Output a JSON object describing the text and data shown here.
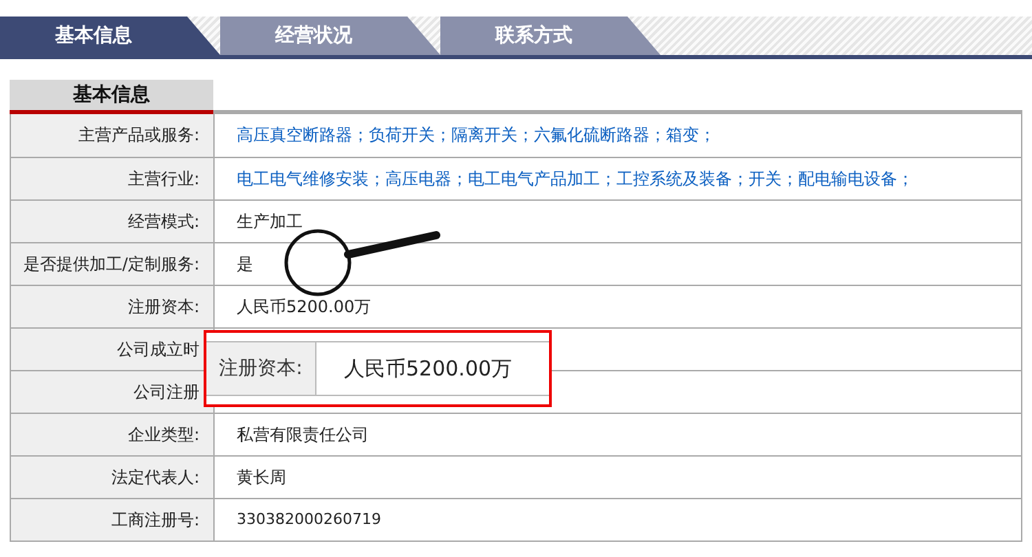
{
  "tabs": [
    {
      "label": "基本信息",
      "selected": true
    },
    {
      "label": "经营状况",
      "selected": false
    },
    {
      "label": "联系方式",
      "selected": false
    }
  ],
  "section_title": "基本信息",
  "rows": [
    {
      "label": "主营产品或服务:",
      "value": "高压真空断路器；负荷开关；隔离开关；六氟化硫断路器；箱变；",
      "kind": "link"
    },
    {
      "label": "主营行业:",
      "value": "电工电气维修安装；高压电器；电工电气产品加工；工控系统及装备；开关；配电输电设备；",
      "kind": "link"
    },
    {
      "label": "经营模式:",
      "value": "生产加工",
      "kind": "text"
    },
    {
      "label": "是否提供加工/定制服务:",
      "value": "是",
      "kind": "text"
    },
    {
      "label": "注册资本:",
      "value": "人民币5200.00万",
      "kind": "text"
    },
    {
      "label": "公司成立时"
    },
    {
      "label": "公司注册"
    },
    {
      "label": "企业类型:",
      "value": "私营有限责任公司",
      "kind": "text"
    },
    {
      "label": "法定代表人:",
      "value": "黄长周",
      "kind": "text"
    },
    {
      "label": "工商注册号:",
      "value": "330382000260719",
      "kind": "number"
    }
  ],
  "magnified": {
    "label": "注册资本:",
    "value": "人民币5200.00万"
  }
}
